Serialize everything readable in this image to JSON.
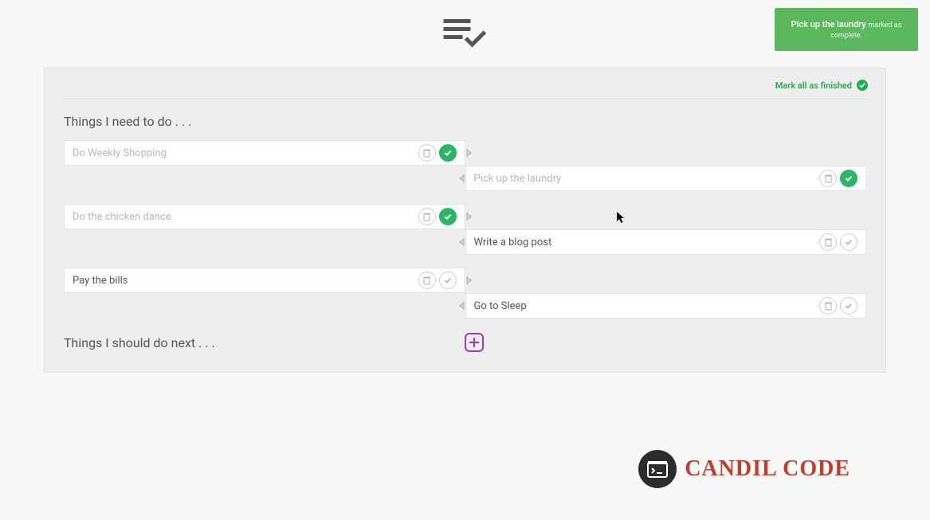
{
  "toast": {
    "title": "Pick up the laundry",
    "sub": "marked as complete."
  },
  "mark_all": "Mark all as finished",
  "heading_todo": "Things I need to do . . .",
  "heading_next": "Things I should do next . . .",
  "left": [
    {
      "text": "Do Weekly Shopping",
      "done": true
    },
    {
      "text": "Do the chicken dance",
      "done": true
    },
    {
      "text": "Pay the bills",
      "done": false
    }
  ],
  "right": [
    {
      "text": "Pick up the laundry",
      "done": true
    },
    {
      "text": "Write a blog post",
      "done": false
    },
    {
      "text": "Go to Sleep",
      "done": false
    }
  ],
  "watermark": "CANDIL CODE",
  "colors": {
    "accent_green": "#29b765",
    "accent_purple": "#9a3fc4",
    "brand_red": "#c53c2c"
  }
}
